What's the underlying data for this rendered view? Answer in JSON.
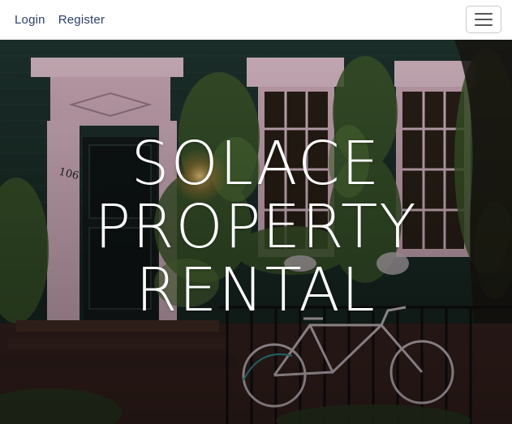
{
  "navbar": {
    "links": [
      "Login",
      "Register"
    ],
    "toggler_icon": "hamburger-menu-icon"
  },
  "hero": {
    "title_lines": [
      "SOLACE",
      "PROPERTY",
      "RENTAL"
    ],
    "house_number": "106",
    "background_image": "ivy-covered-house-with-bicycle-photo"
  },
  "colors": {
    "navbar_bg": "#ffffff",
    "nav_link": "#2b3f6b",
    "hero_text": "#ffffff"
  }
}
